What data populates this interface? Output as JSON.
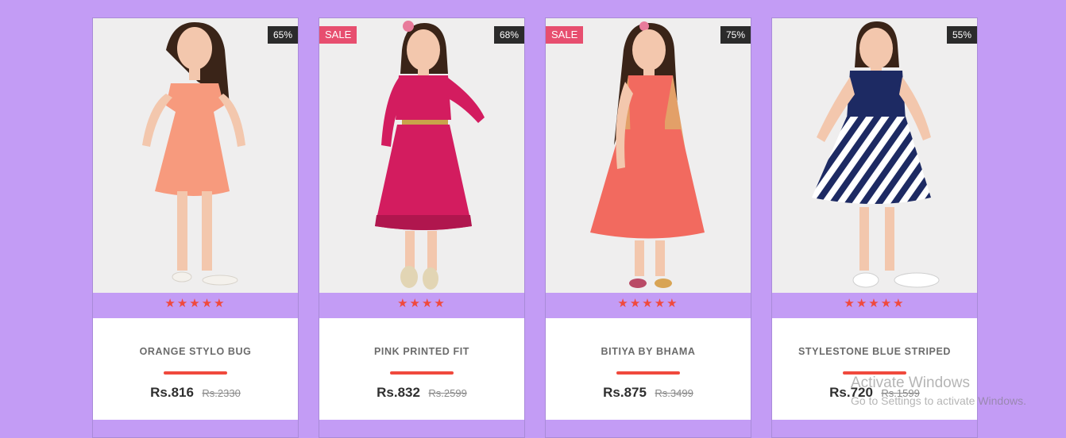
{
  "products": [
    {
      "name": "ORANGE STYLO BUG",
      "price": "Rs.816",
      "old_price": "Rs.2330",
      "discount": "65%",
      "sale": "",
      "stars": "★★★★★",
      "dress_color": "#f79a7d",
      "dress_accent": "#f28468"
    },
    {
      "name": "PINK PRINTED FIT",
      "price": "Rs.832",
      "old_price": "Rs.2599",
      "discount": "68%",
      "sale": "SALE",
      "stars": "★★★★",
      "dress_color": "#d31c5f",
      "dress_accent": "#c9a24a"
    },
    {
      "name": "BITIYA BY BHAMA",
      "price": "Rs.875",
      "old_price": "Rs.3499",
      "discount": "75%",
      "sale": "SALE",
      "stars": "★★★★★",
      "dress_color": "#f26a5f",
      "dress_accent": "#e3a068"
    },
    {
      "name": "STYLESTONE BLUE STRIPED",
      "price": "Rs.720",
      "old_price": "Rs.1599",
      "discount": "55%",
      "sale": "",
      "stars": "★★★★★",
      "dress_color": "#1d2a63",
      "dress_accent": "#ffffff"
    }
  ],
  "watermark": {
    "line1": "Activate Windows",
    "line2": "Go to Settings to activate Windows."
  },
  "colors": {
    "background": "#c39cf5",
    "star": "#f0493d",
    "sale": "#e74e6f",
    "discount": "#2b2b2b"
  }
}
